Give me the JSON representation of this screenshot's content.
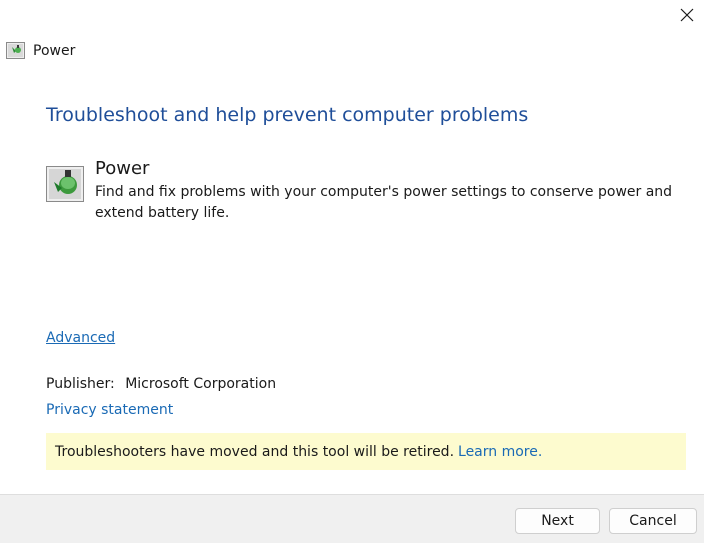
{
  "window": {
    "title": "Power",
    "close_icon": "close-icon",
    "app_icon": "power-troubleshooter-icon"
  },
  "main": {
    "heading": "Troubleshoot and help prevent computer problems",
    "tool": {
      "icon": "power-troubleshooter-icon",
      "name": "Power",
      "description": "Find and fix problems with your computer's power settings to conserve power and extend battery life."
    },
    "advanced_link": "Advanced",
    "publisher_label": "Publisher:",
    "publisher_value": "Microsoft Corporation",
    "privacy_link": "Privacy statement",
    "banner": {
      "text": "Troubleshooters have moved and this tool will be retired.",
      "link": "Learn more."
    }
  },
  "footer": {
    "next_label": "Next",
    "cancel_label": "Cancel"
  },
  "colors": {
    "heading": "#1f4e99",
    "link": "#1a6ab5",
    "banner_bg": "#fdfbcf",
    "footer_bg": "#f0f0f0"
  }
}
